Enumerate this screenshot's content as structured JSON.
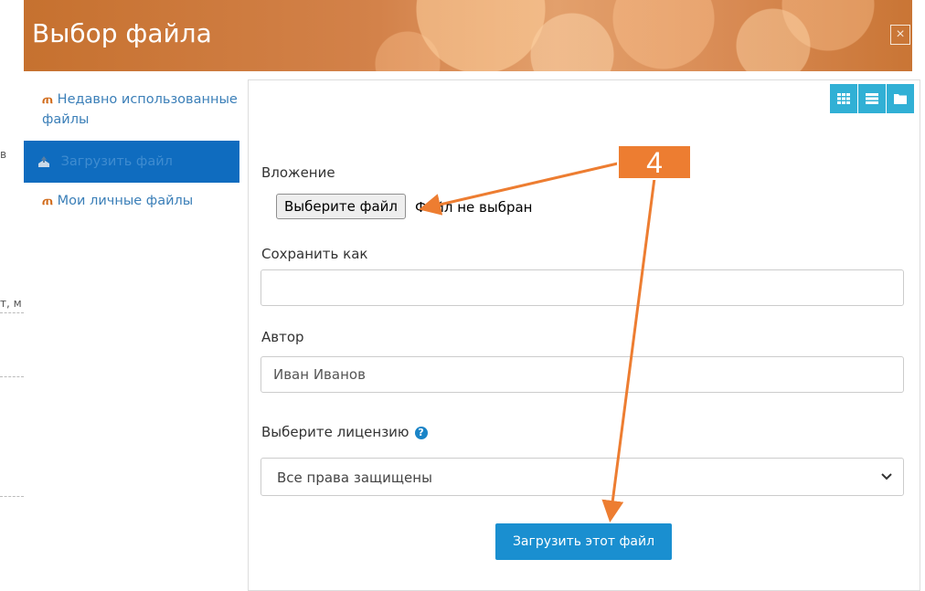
{
  "background": {
    "fragments": [
      "в",
      "т, м"
    ]
  },
  "dialog": {
    "title": "Выбор файла",
    "close_icon": "close-icon",
    "close_glyph": "×"
  },
  "sidebar": {
    "items": [
      {
        "label": "Недавно использованные файлы",
        "icon": "moodle-icon",
        "active": false
      },
      {
        "label": "Загрузить файл",
        "icon": "upload-icon",
        "active": true
      },
      {
        "label": "Мои личные файлы",
        "icon": "moodle-icon",
        "active": false
      }
    ],
    "icon_glyph": "ጠ"
  },
  "view_toggle": {
    "buttons": [
      "grid-view-icon",
      "list-view-icon",
      "folder-view-icon"
    ],
    "color": "#31b0d5"
  },
  "form": {
    "attachment_label": "Вложение",
    "file_button_label": "Выберите файл",
    "no_file_text": "Файл не выбран",
    "save_as_label": "Сохранить как",
    "save_as_value": "",
    "author_label": "Автор",
    "author_value": "Иван Иванов",
    "license_label": "Выберите лицензию",
    "help_glyph": "?",
    "license_value": "Все права защищены",
    "upload_button_label": "Загрузить этот файл"
  },
  "annotation": {
    "badge_text": "4",
    "color": "#ed7d31"
  }
}
